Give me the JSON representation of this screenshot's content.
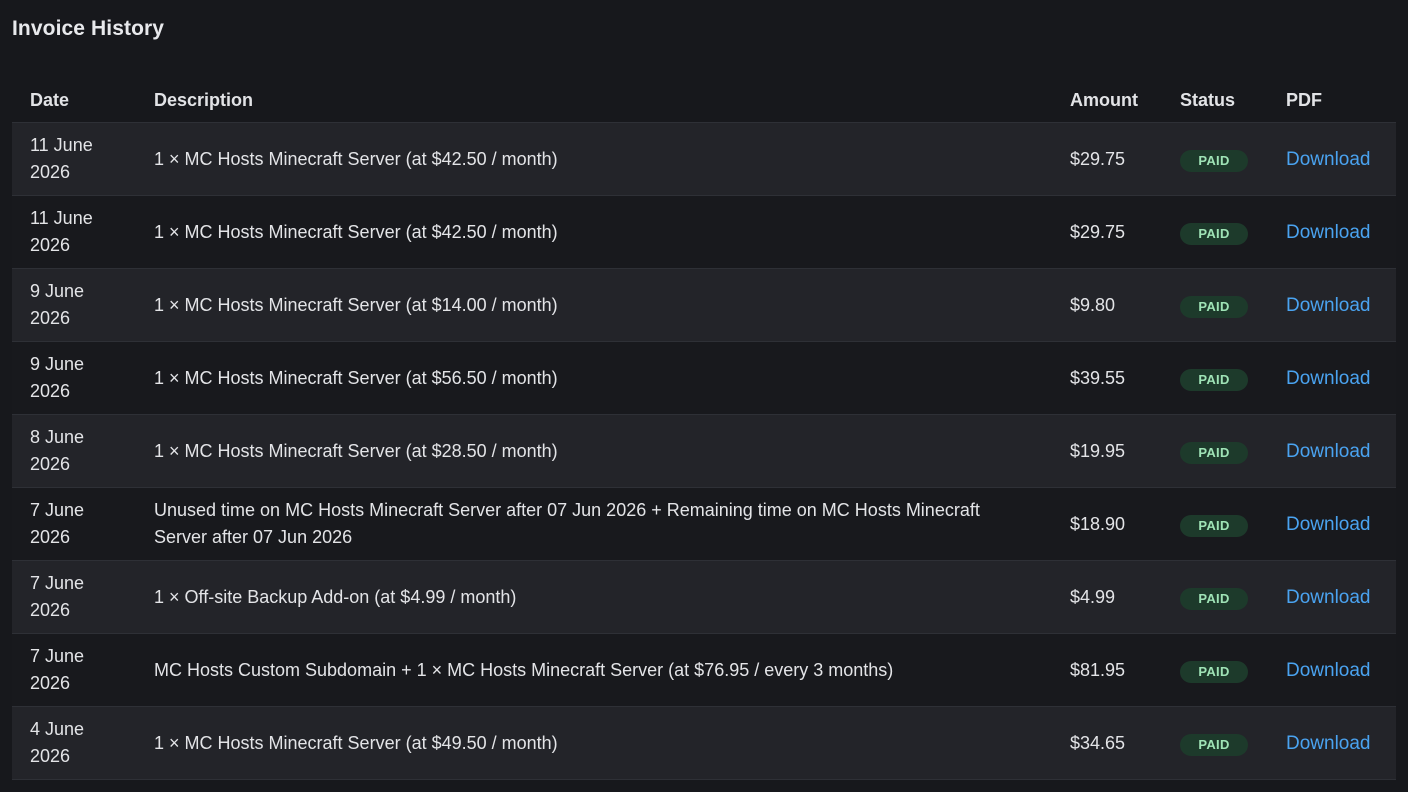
{
  "page": {
    "title": "Invoice History"
  },
  "table": {
    "headers": {
      "date": "Date",
      "description": "Description",
      "amount": "Amount",
      "status": "Status",
      "pdf": "PDF"
    },
    "rows": [
      {
        "date_line1": "11 June",
        "date_line2": "2026",
        "description": "1 × MC Hosts Minecraft Server (at $42.50 / month)",
        "amount": "$29.75",
        "status": "PAID",
        "pdf": "Download"
      },
      {
        "date_line1": "11 June",
        "date_line2": "2026",
        "description": "1 × MC Hosts Minecraft Server (at $42.50 / month)",
        "amount": "$29.75",
        "status": "PAID",
        "pdf": "Download"
      },
      {
        "date_line1": "9 June",
        "date_line2": "2026",
        "description": "1 × MC Hosts Minecraft Server (at $14.00 / month)",
        "amount": "$9.80",
        "status": "PAID",
        "pdf": "Download"
      },
      {
        "date_line1": "9 June",
        "date_line2": "2026",
        "description": "1 × MC Hosts Minecraft Server (at $56.50 / month)",
        "amount": "$39.55",
        "status": "PAID",
        "pdf": "Download"
      },
      {
        "date_line1": "8 June",
        "date_line2": "2026",
        "description": "1 × MC Hosts Minecraft Server (at $28.50 / month)",
        "amount": "$19.95",
        "status": "PAID",
        "pdf": "Download"
      },
      {
        "date_line1": "7 June",
        "date_line2": "2026",
        "description": "Unused time on MC Hosts Minecraft Server after 07 Jun 2026 + Remaining time on MC Hosts Minecraft Server after 07 Jun 2026",
        "amount": "$18.90",
        "status": "PAID",
        "pdf": "Download"
      },
      {
        "date_line1": "7 June",
        "date_line2": "2026",
        "description": "1 × Off-site Backup Add-on (at $4.99 / month)",
        "amount": "$4.99",
        "status": "PAID",
        "pdf": "Download"
      },
      {
        "date_line1": "7 June",
        "date_line2": "2026",
        "description": "MC Hosts Custom Subdomain + 1 × MC Hosts Minecraft Server (at $76.95 / every 3 months)",
        "amount": "$81.95",
        "status": "PAID",
        "pdf": "Download"
      },
      {
        "date_line1": "4 June",
        "date_line2": "2026",
        "description": "1 × MC Hosts Minecraft Server (at $49.50 / month)",
        "amount": "$34.65",
        "status": "PAID",
        "pdf": "Download"
      }
    ]
  },
  "colors": {
    "background": "#17181c",
    "row_alt": "#232429",
    "link": "#4aa3f0",
    "badge_bg": "#1d3a2b",
    "badge_text": "#9fe3b6"
  }
}
